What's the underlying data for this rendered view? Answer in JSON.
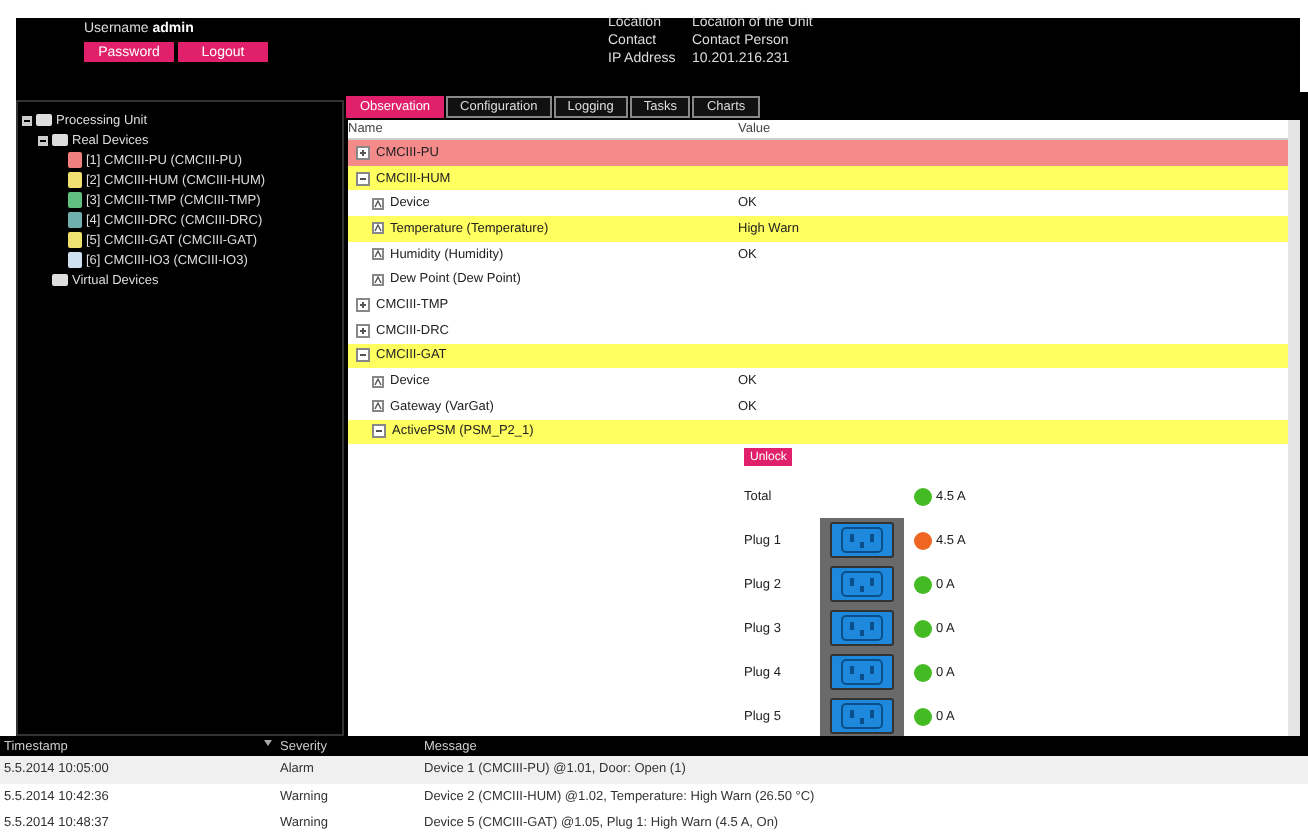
{
  "header": {
    "username_label": "Username",
    "username": "admin",
    "buttons": [
      "Password",
      "Logout"
    ],
    "info": [
      {
        "label": "Location",
        "value": "Location of the Unit"
      },
      {
        "label": "Contact",
        "value": "Contact Person"
      },
      {
        "label": "IP Address",
        "value": "10.201.216.231"
      }
    ]
  },
  "tree": [
    {
      "label": "Processing Unit",
      "kind": "folder",
      "expanded": true,
      "children": [
        {
          "label": "Real Devices",
          "kind": "folder",
          "expanded": true,
          "children": [
            {
              "label": "[1] CMCIII-PU (CMCIII-PU)",
              "kind": "device",
              "color": "#f08080"
            },
            {
              "label": "[2] CMCIII-HUM (CMCIII-HUM)",
              "kind": "device",
              "color": "#f0e070"
            },
            {
              "label": "[3] CMCIII-TMP (CMCIII-TMP)",
              "kind": "device",
              "color": "#60c080"
            },
            {
              "label": "[4] CMCIII-DRC (CMCIII-DRC)",
              "kind": "device",
              "color": "#70b0b0"
            },
            {
              "label": "[5] CMCIII-GAT (CMCIII-GAT)",
              "kind": "device",
              "color": "#f0e070"
            },
            {
              "label": "[6] CMCIII-IO3 (CMCIII-IO3)",
              "kind": "device",
              "color": "#d0e0f0"
            }
          ]
        },
        {
          "label": "Virtual Devices",
          "kind": "folder"
        }
      ]
    }
  ],
  "tabs": [
    {
      "label": "Observation",
      "selected": true
    },
    {
      "label": "Configuration",
      "selected": false
    },
    {
      "label": "Logging",
      "selected": false
    },
    {
      "label": "Tasks",
      "selected": false
    },
    {
      "label": "Charts",
      "selected": false
    }
  ],
  "table": {
    "columns": [
      "Name",
      "Value"
    ],
    "rows": [
      {
        "name": "CMCIII-PU",
        "kind": "group",
        "color": "#f58a8a",
        "expanded": false
      },
      {
        "name": "CMCIII-HUM",
        "kind": "group",
        "color": "#ffff60",
        "expanded": true,
        "children": [
          {
            "name": "Device",
            "kind": "value",
            "value": "OK"
          },
          {
            "name": "Temperature (Temperature)",
            "kind": "value",
            "color": "#ffff60",
            "value": "High Warn"
          },
          {
            "name": "Humidity (Humidity)",
            "kind": "value",
            "value": "OK"
          },
          {
            "name": "Dew Point (Dew Point)",
            "kind": "value"
          }
        ]
      },
      {
        "name": "CMCIII-TMP",
        "kind": "group",
        "expanded": false
      },
      {
        "name": "CMCIII-DRC",
        "kind": "group",
        "expanded": false
      },
      {
        "name": "CMCIII-GAT",
        "kind": "group",
        "color": "#ffff60",
        "expanded": true,
        "children": [
          {
            "name": "Device",
            "kind": "value",
            "value": "OK"
          },
          {
            "name": "Gateway (VarGat)",
            "kind": "value",
            "value": "OK"
          },
          {
            "name": "ActivePSM (PSM_P2_1)",
            "kind": "group",
            "color": "#ffff60",
            "expanded": true
          }
        ]
      }
    ],
    "psm_panel": {
      "button": "Unlock",
      "readings": [
        {
          "label": "Total",
          "kind": "total",
          "reading": "4.5 A",
          "color": "#44bb22"
        },
        {
          "label": "Plug 1",
          "kind": "plug",
          "reading": "4.5 A",
          "color": "#ee6622"
        },
        {
          "label": "Plug 2",
          "kind": "plug",
          "reading": "0 A",
          "color": "#44bb22"
        },
        {
          "label": "Plug 3",
          "kind": "plug",
          "reading": "0 A",
          "color": "#44bb22"
        },
        {
          "label": "Plug 4",
          "kind": "plug",
          "reading": "0 A",
          "color": "#44bb22"
        },
        {
          "label": "Plug 5",
          "kind": "plug",
          "reading": "0 A",
          "color": "#44bb22"
        }
      ]
    }
  },
  "log": {
    "columns": [
      "Timestamp",
      "Severity",
      "Message"
    ],
    "rows": [
      [
        "5.5.2014 10:05:00",
        "Alarm",
        "Device 1 (CMCIII-PU) @1.01, Door: Open (1)"
      ],
      [
        "5.5.2014 10:42:36",
        "Warning",
        "Device 2 (CMCIII-HUM) @1.02, Temperature: High Warn (26.50 °C)"
      ],
      [
        "5.5.2014 10:48:37",
        "Warning",
        "Device 5 (CMCIII-GAT) @1.05, Plug 1: High Warn (4.5 A, On)"
      ]
    ]
  }
}
